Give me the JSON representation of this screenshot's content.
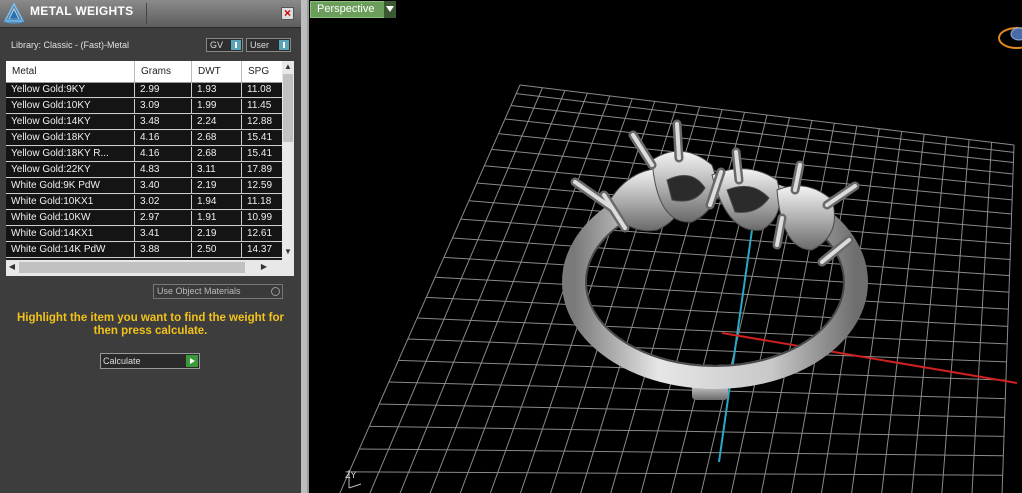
{
  "panel": {
    "title": "METAL WEIGHTS",
    "library_label": "Library: Classic - (Fast)-Metal",
    "gv_dropdown": "GV",
    "user_dropdown": "User",
    "columns": [
      "Metal",
      "Grams",
      "DWT",
      "SPG"
    ],
    "rows": [
      [
        "Yellow Gold:9KY",
        "2.99",
        "1.93",
        "11.08"
      ],
      [
        "Yellow Gold:10KY",
        "3.09",
        "1.99",
        "11.45"
      ],
      [
        "Yellow Gold:14KY",
        "3.48",
        "2.24",
        "12.88"
      ],
      [
        "Yellow Gold:18KY",
        "4.16",
        "2.68",
        "15.41"
      ],
      [
        "Yellow Gold:18KY R...",
        "4.16",
        "2.68",
        "15.41"
      ],
      [
        "Yellow Gold:22KY",
        "4.83",
        "3.11",
        "17.89"
      ],
      [
        "White Gold:9K PdW",
        "3.40",
        "2.19",
        "12.59"
      ],
      [
        "White Gold:10KX1",
        "3.02",
        "1.94",
        "11.18"
      ],
      [
        "White Gold:10KW",
        "2.97",
        "1.91",
        "10.99"
      ],
      [
        "White Gold:14KX1",
        "3.41",
        "2.19",
        "12.61"
      ],
      [
        "White Gold:14K PdW",
        "3.88",
        "2.50",
        "14.37"
      ]
    ],
    "use_object_materials": "Use Object Materials",
    "hint": "Highlight the item you want to find the weight for then press calculate.",
    "calculate_label": "Calculate"
  },
  "viewport": {
    "label": "Perspective",
    "axis_label": "ZY"
  },
  "colors": {
    "hint": "#f2c21b",
    "viewport_label_bg": "#6a9e5a",
    "axis_x": "#d02020",
    "axis_y": "#2aa8c8"
  }
}
